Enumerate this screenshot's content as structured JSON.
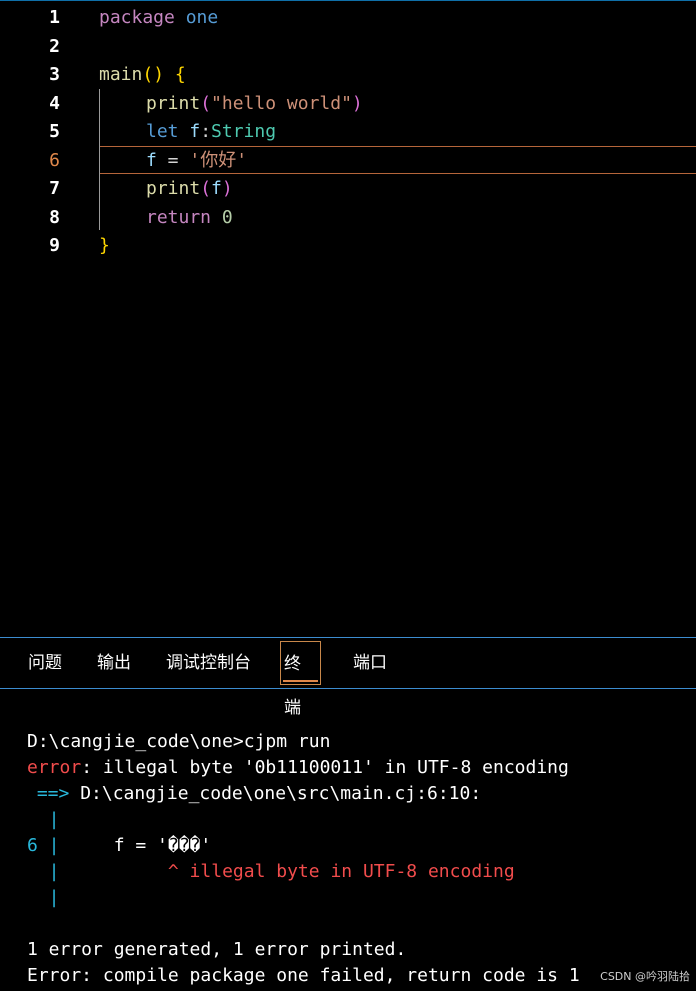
{
  "editor": {
    "lines": [
      {
        "n": "1",
        "t": [
          {
            "c": "kw",
            "s": "package "
          },
          {
            "c": "kw2",
            "s": "one"
          }
        ]
      },
      {
        "n": "2",
        "t": []
      },
      {
        "n": "3",
        "t": [
          {
            "c": "fn",
            "s": "main"
          },
          {
            "c": "br",
            "s": "() {"
          }
        ]
      },
      {
        "n": "4",
        "i": true,
        "t": [
          {
            "c": "fn",
            "s": "print"
          },
          {
            "c": "br2",
            "s": "("
          },
          {
            "c": "str",
            "s": "\"hello world\""
          },
          {
            "c": "br2",
            "s": ")"
          }
        ]
      },
      {
        "n": "5",
        "i": true,
        "t": [
          {
            "c": "kw2",
            "s": "let "
          },
          {
            "c": "vr",
            "s": "f"
          },
          {
            "c": "wh",
            "s": ":"
          },
          {
            "c": "ty",
            "s": "String"
          }
        ]
      },
      {
        "n": "6",
        "i": true,
        "active": true,
        "t": [
          {
            "c": "vr",
            "s": "f"
          },
          {
            "c": "wh",
            "s": " = "
          },
          {
            "c": "str",
            "s": "'你好'"
          }
        ]
      },
      {
        "n": "7",
        "i": true,
        "t": [
          {
            "c": "fn",
            "s": "print"
          },
          {
            "c": "br2",
            "s": "("
          },
          {
            "c": "vr",
            "s": "f"
          },
          {
            "c": "br2",
            "s": ")"
          }
        ]
      },
      {
        "n": "8",
        "i": true,
        "t": [
          {
            "c": "kw",
            "s": "return "
          },
          {
            "c": "num",
            "s": "0"
          }
        ]
      },
      {
        "n": "9",
        "t": [
          {
            "c": "br",
            "s": "}"
          }
        ]
      }
    ]
  },
  "panel": {
    "tabs": [
      {
        "label": "问题",
        "name": "tab-problems"
      },
      {
        "label": "输出",
        "name": "tab-output"
      },
      {
        "label": "调试控制台",
        "name": "tab-debug-console"
      },
      {
        "label": "终端",
        "name": "tab-terminal",
        "active": true
      },
      {
        "label": "端口",
        "name": "tab-ports"
      }
    ]
  },
  "terminal": {
    "cmd": "D:\\cangjie_code\\one>cjpm run",
    "err_label": "error",
    "err_msg": ": illegal byte '0b11100011' in UTF-8 encoding",
    "arrow": " ==>",
    "loc": " D:\\cangjie_code\\one\\src\\main.cj:6:10:",
    "pipe": "  |",
    "src_line_no": "6 |",
    "src_code": "     f = '���'",
    "caret": "          ^ illegal byte in UTF-8 encoding",
    "summary": "1 error generated, 1 error printed.",
    "final": "Error: compile package one failed, return code is 1"
  },
  "watermark": "CSDN @吟羽陆拾"
}
